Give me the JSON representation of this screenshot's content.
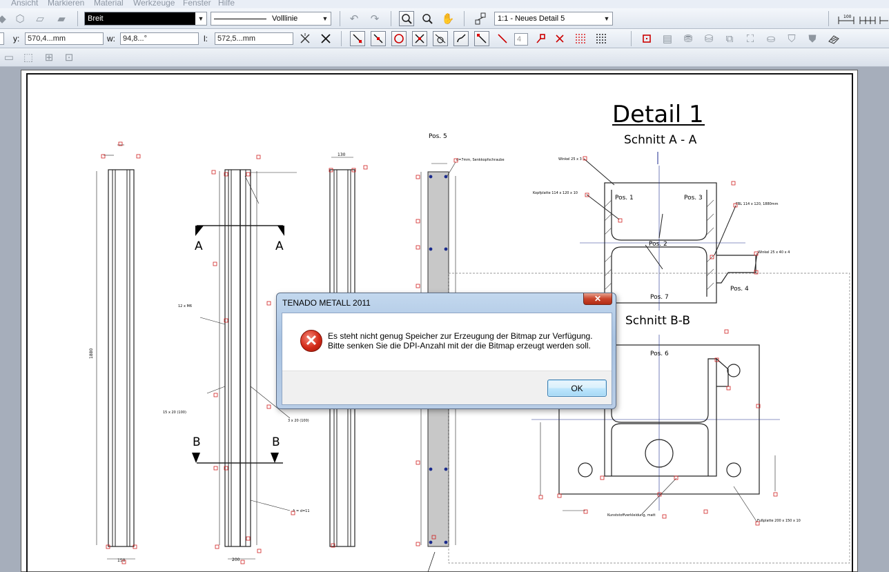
{
  "menu": [
    "Ansicht",
    "Markieren",
    "Material",
    "Werkzeuge",
    "Fenster",
    "Hilfe"
  ],
  "toolbar": {
    "line_width": "Breit",
    "line_type": "Volllinie",
    "detail_select": "1:1 - Neues Detail 5"
  },
  "coords": {
    "y_label": "y:",
    "y_value": "570,4...mm",
    "w_label": "w:",
    "w_value": "94,8...°",
    "l_label": "l:",
    "l_value": "572,5...mm",
    "count_value": "4"
  },
  "drawing": {
    "title": "Detail 1",
    "section_aa": "Schnitt A - A",
    "section_bb": "Schnitt B-B",
    "marker_a": "A",
    "marker_b": "B",
    "pos1": "Pos. 1",
    "pos2": "Pos. 2",
    "pos3": "Pos. 3",
    "pos4": "Pos. 4",
    "pos5": "Pos. 5",
    "pos6": "Pos. 6",
    "pos7": "Pos. 7",
    "note_screw": "d=7mm, Senkkopfschraube",
    "note_angle1": "Winkel 25 x 3",
    "note_plate": "Kopfplatte 114 x 120 x 10",
    "note_flat": "FBL 114 x 120, 1880mm",
    "note_angle2": "Winkel 25 x 40 x 4",
    "note_foot": "Fußplatte 200 x 150 x 10",
    "note_plastic": "Kunststoffverkleidung, matt",
    "note_holes": "12 x M6",
    "note_weld1": "15 x 20 (100)",
    "note_weld2": "3 x 20 (100)",
    "note_pitch": "A = d=11",
    "dim_1880": "1880",
    "dim_150": "150",
    "dim_200": "200",
    "dim_130": "130"
  },
  "dialog": {
    "title": "TENADO METALL 2011",
    "message": "Es steht nicht genug Speicher zur Erzeugung der Bitmap zur Verfügung.\nBitte senken Sie die DPI-Anzahl mit der die Bitmap erzeugt werden soll.",
    "ok_label": "OK",
    "close_label": "✕"
  }
}
